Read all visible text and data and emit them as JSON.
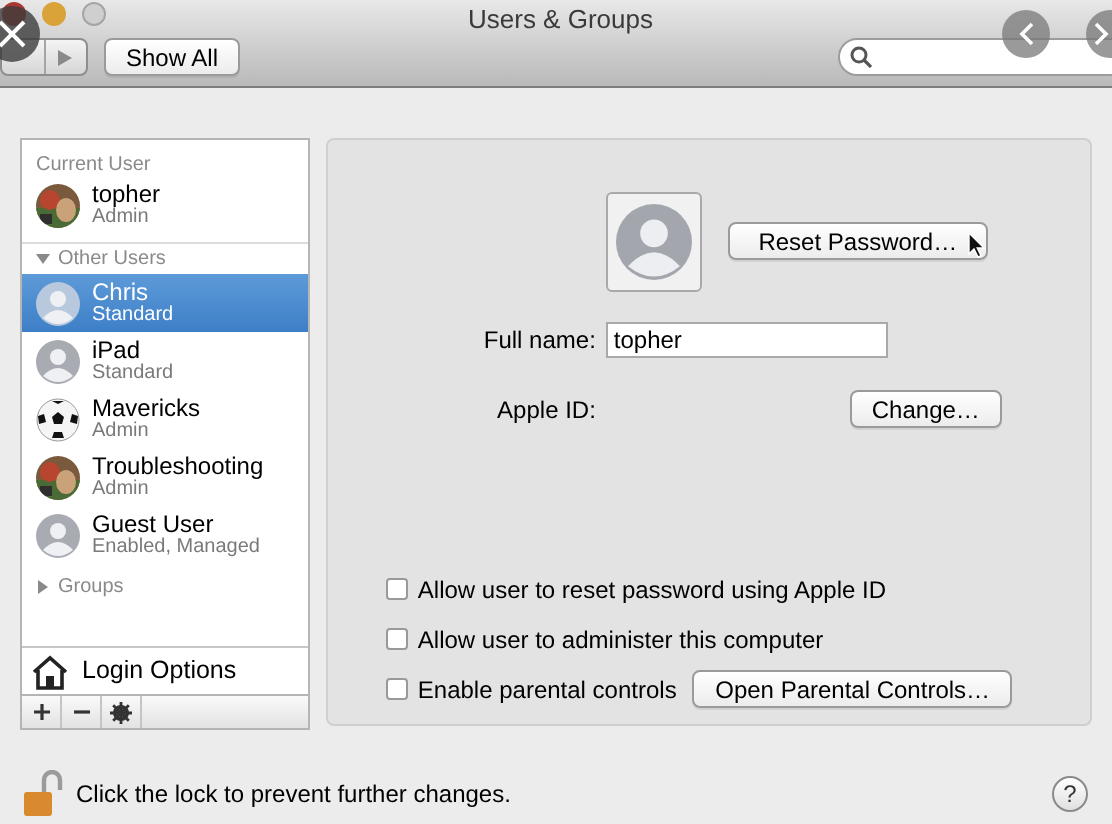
{
  "window": {
    "title": "Users & Groups"
  },
  "toolbar": {
    "show_all": "Show All"
  },
  "sidebar": {
    "current_header": "Current User",
    "current_user": {
      "name": "topher",
      "role": "Admin",
      "selected": false
    },
    "other_header": "Other Users",
    "other_expanded": true,
    "other_users": [
      {
        "name": "Chris",
        "role": "Standard",
        "kind": "silhouette",
        "selected": true
      },
      {
        "name": "iPad",
        "role": "Standard",
        "kind": "silhouette",
        "selected": false
      },
      {
        "name": "Mavericks",
        "role": "Admin",
        "kind": "ball",
        "selected": false
      },
      {
        "name": "Troubleshooting",
        "role": "Admin",
        "selected": false
      },
      {
        "name": "Guest User",
        "role": "Enabled, Managed",
        "kind": "silhouette",
        "selected": false
      }
    ],
    "groups": {
      "label": "Groups",
      "expanded": false
    },
    "login_options": "Login Options"
  },
  "detail": {
    "reset_password": "Reset Password…",
    "full_name_label": "Full name:",
    "full_name": "topher",
    "apple_id_label": "Apple ID:",
    "change": "Change…",
    "options": [
      {
        "label": "Allow user to reset password using Apple ID",
        "checked": false
      },
      {
        "label": "Allow user to administer this computer",
        "checked": false
      },
      {
        "label": "Enable parental controls",
        "checked": false,
        "button": "Open Parental Controls…"
      }
    ]
  },
  "footer": {
    "lock_text": "Click the lock to prevent further changes.",
    "locked": false,
    "help": "?"
  }
}
